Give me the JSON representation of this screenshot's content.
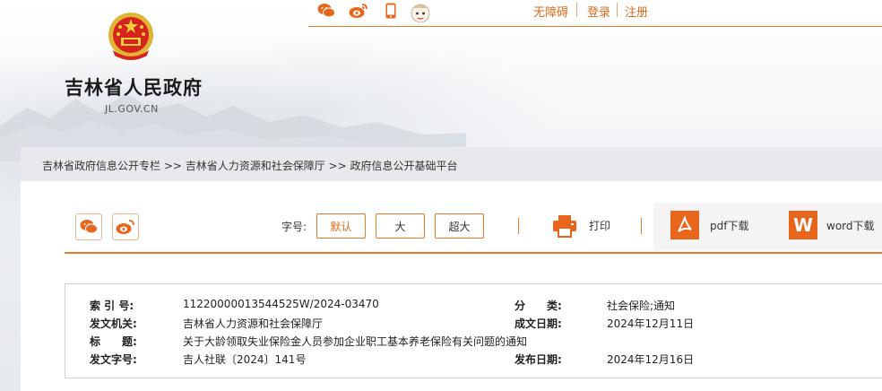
{
  "header": {
    "site_title": "吉林省人民政府",
    "site_domain": "JL.GOV.CN",
    "links": {
      "accessibility": "无障碍",
      "login": "登录",
      "register": "注册"
    },
    "icons": [
      "wechat-icon",
      "weibo-icon",
      "mobile-icon",
      "mascot-icon"
    ]
  },
  "breadcrumb": {
    "text": "吉林省政府信息公开专栏 >> 吉林省人力资源和社会保障厅 >> 政府信息公开基础平台"
  },
  "toolbar": {
    "font_label": "字号:",
    "font_default": "默认",
    "font_large": "大",
    "font_xlarge": "超大",
    "print": "打印",
    "pdf": "pdf下载",
    "word": "word下载"
  },
  "meta": {
    "index_label": "索 引 号:",
    "index_value": "11220000013544525W/2024-03470",
    "category_label": "分　　类:",
    "category_value": "社会保险;通知",
    "issuer_label": "发文机关:",
    "issuer_value": "吉林省人力资源和社会保障厅",
    "created_label": "成文日期:",
    "created_value": "2024年12月11日",
    "title_label": "标　　题:",
    "title_value": "关于大龄领取失业保险金人员参加企业职工基本养老保险有关问题的通知",
    "doc_no_label": "发文字号:",
    "doc_no_value": "吉人社联〔2024〕141号",
    "published_label": "发布日期:",
    "published_value": "2024年12月16日"
  },
  "colors": {
    "accent": "#e47a2c",
    "accent_text": "#d86a1a",
    "icon_fill": "#e8661c"
  }
}
